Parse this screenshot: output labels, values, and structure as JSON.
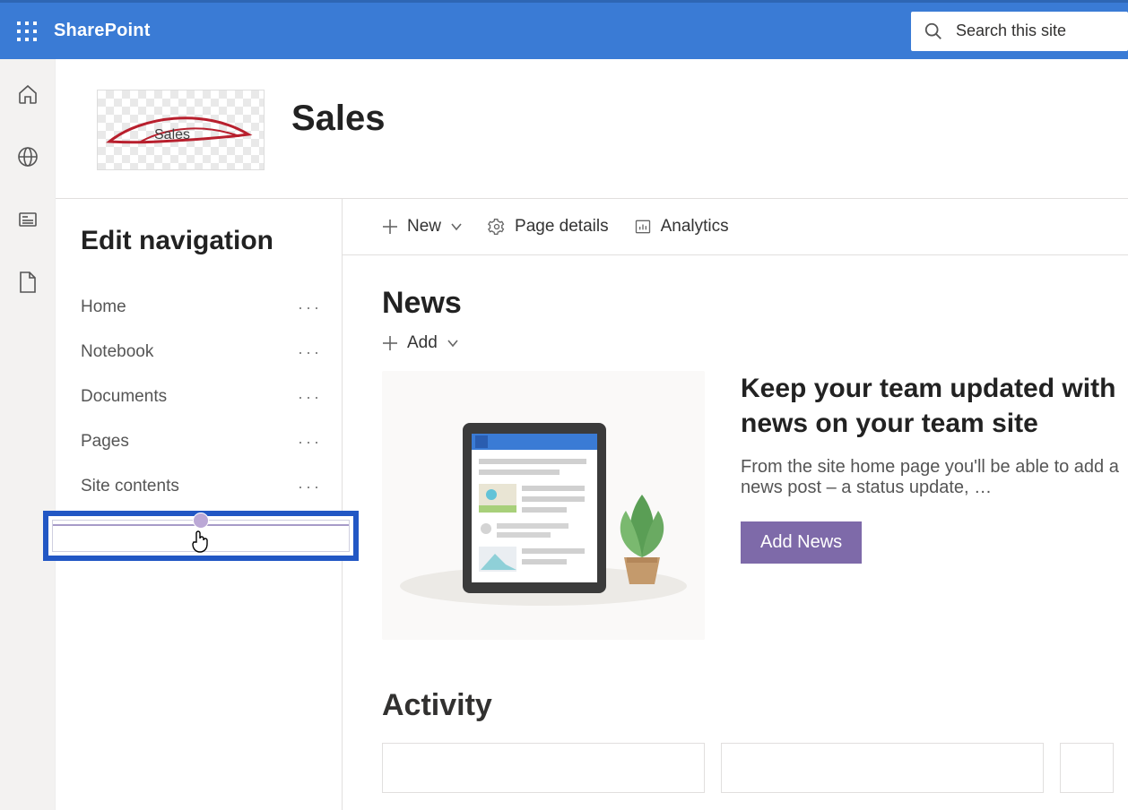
{
  "appbar": {
    "brand": "SharePoint"
  },
  "search": {
    "placeholder": "Search this site"
  },
  "site": {
    "crumb": "Sales",
    "title": "Sales"
  },
  "leftnav": {
    "heading": "Edit navigation",
    "items": [
      {
        "label": "Home"
      },
      {
        "label": "Notebook"
      },
      {
        "label": "Documents"
      },
      {
        "label": "Pages"
      },
      {
        "label": "Site contents"
      }
    ]
  },
  "commands": {
    "new": "New",
    "pageDetails": "Page details",
    "analytics": "Analytics"
  },
  "news": {
    "heading": "News",
    "addLabel": "Add",
    "promoTitle": "Keep your team updated with news on your team site",
    "promoBody": "From the site home page you'll be able to add a news post – a status update, …",
    "addNewsButton": "Add News"
  },
  "activity": {
    "heading": "Activity"
  }
}
